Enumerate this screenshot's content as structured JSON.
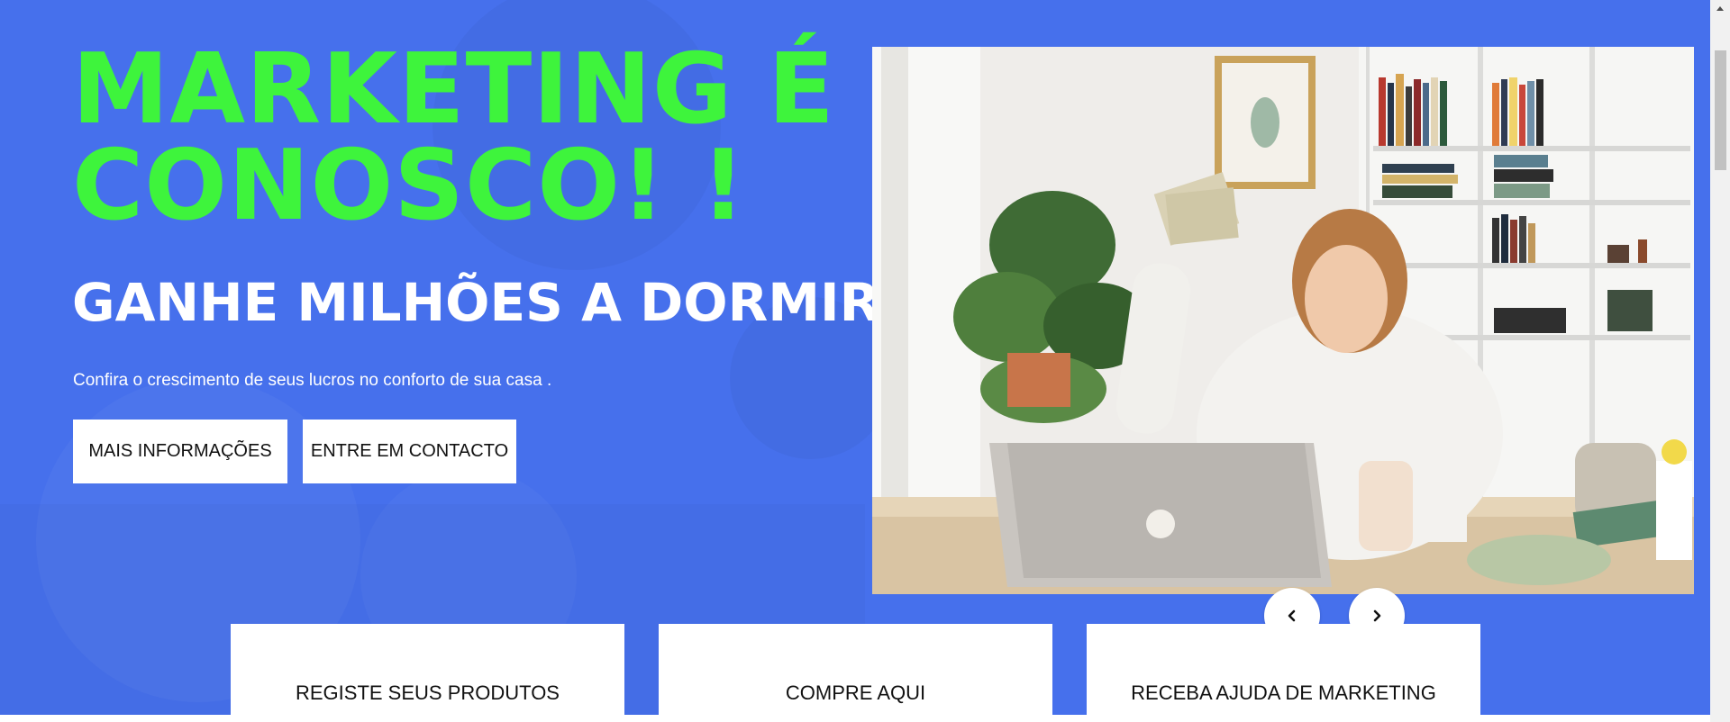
{
  "hero": {
    "headline": "MARKETING É CONOSCO! !",
    "subheadline": "GANHE MILHÕES A DORMIR",
    "lead": "Confira o crescimento de seus lucros no conforto de sua casa .",
    "buttons": {
      "more_info": "MAIS INFORMAÇÕES",
      "contact": "ENTRE EM CONTACTO"
    },
    "colors": {
      "background": "#4670ec",
      "headline": "#3ef43c",
      "text": "#ffffff"
    }
  },
  "carousel": {
    "image": "woman-holding-cash-at-laptop",
    "prev_icon": "chevron-left-icon",
    "next_icon": "chevron-right-icon"
  },
  "features": [
    {
      "label": "REGISTE SEUS PRODUTOS"
    },
    {
      "label": "COMPRE AQUI"
    },
    {
      "label": "RECEBA AJUDA DE MARKETING"
    }
  ],
  "scrollbar": {
    "up_icon": "scroll-up-arrow-icon"
  }
}
